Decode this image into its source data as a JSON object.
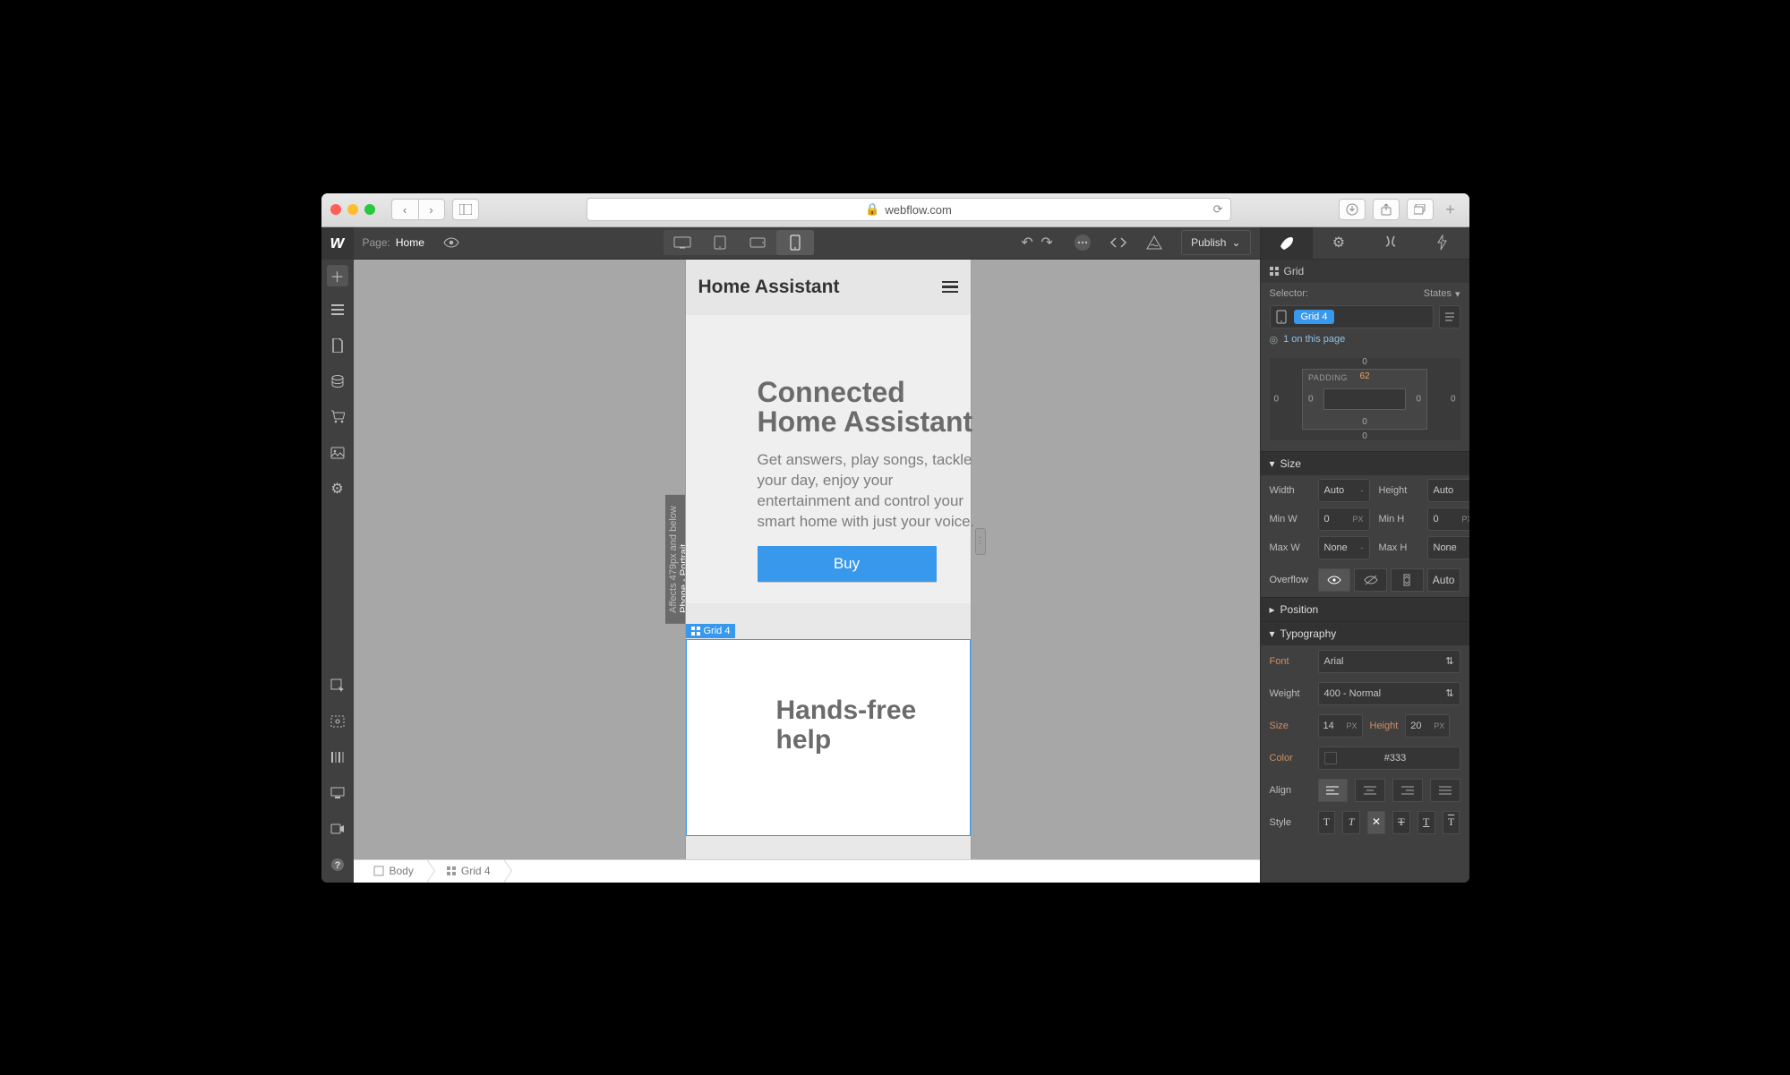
{
  "browser": {
    "url_host": "webflow.com"
  },
  "left_tools": {
    "page_label": "Page:",
    "page_name": "Home"
  },
  "publish_label": "Publish",
  "right_panel": {
    "element_label": "Grid",
    "selector_label": "Selector:",
    "states_label": "States",
    "selector_class": "Grid 4",
    "onpage_text": "1 on this page",
    "padding_label": "PADDING",
    "margin": {
      "top": "0",
      "right": "0",
      "bottom": "0",
      "left": "0"
    },
    "padding": {
      "top": "62",
      "right": "0",
      "bottom": "0",
      "left": "0"
    },
    "sections": {
      "size": "Size",
      "position": "Position",
      "typography": "Typography"
    },
    "size": {
      "width_label": "Width",
      "width_val": "Auto",
      "height_label": "Height",
      "height_val": "Auto",
      "minw_label": "Min W",
      "minw_val": "0",
      "minw_unit": "PX",
      "minh_label": "Min H",
      "minh_val": "0",
      "minh_unit": "PX",
      "maxw_label": "Max W",
      "maxw_val": "None",
      "maxh_label": "Max H",
      "maxh_val": "None",
      "overflow_label": "Overflow",
      "overflow_auto": "Auto"
    },
    "typo": {
      "font_label": "Font",
      "font_val": "Arial",
      "weight_label": "Weight",
      "weight_val": "400 - Normal",
      "size_label": "Size",
      "size_val": "14",
      "size_unit": "PX",
      "height_label": "Height",
      "height_val": "20",
      "height_unit": "PX",
      "color_label": "Color",
      "color_val": "#333",
      "align_label": "Align",
      "style_label": "Style"
    }
  },
  "canvas": {
    "breakpoint_badge_active": "Phone - Portrait",
    "breakpoint_badge_rule": "Affects 479px and below",
    "page_title": "Home Assistant",
    "hero_h1_a": "Connected",
    "hero_h1_b": "Home Assistant",
    "hero_p1": "Get answers, play songs, tackle",
    "hero_p2": "your day, enjoy your",
    "hero_p3": "entertainment and control your",
    "hero_p4": "smart home with just your voice.",
    "hero_btn": "Buy",
    "selected_label": "Grid 4",
    "section_h2_a": "Hands-free",
    "section_h2_b": "help"
  },
  "breadcrumbs": {
    "body": "Body",
    "grid": "Grid 4"
  }
}
